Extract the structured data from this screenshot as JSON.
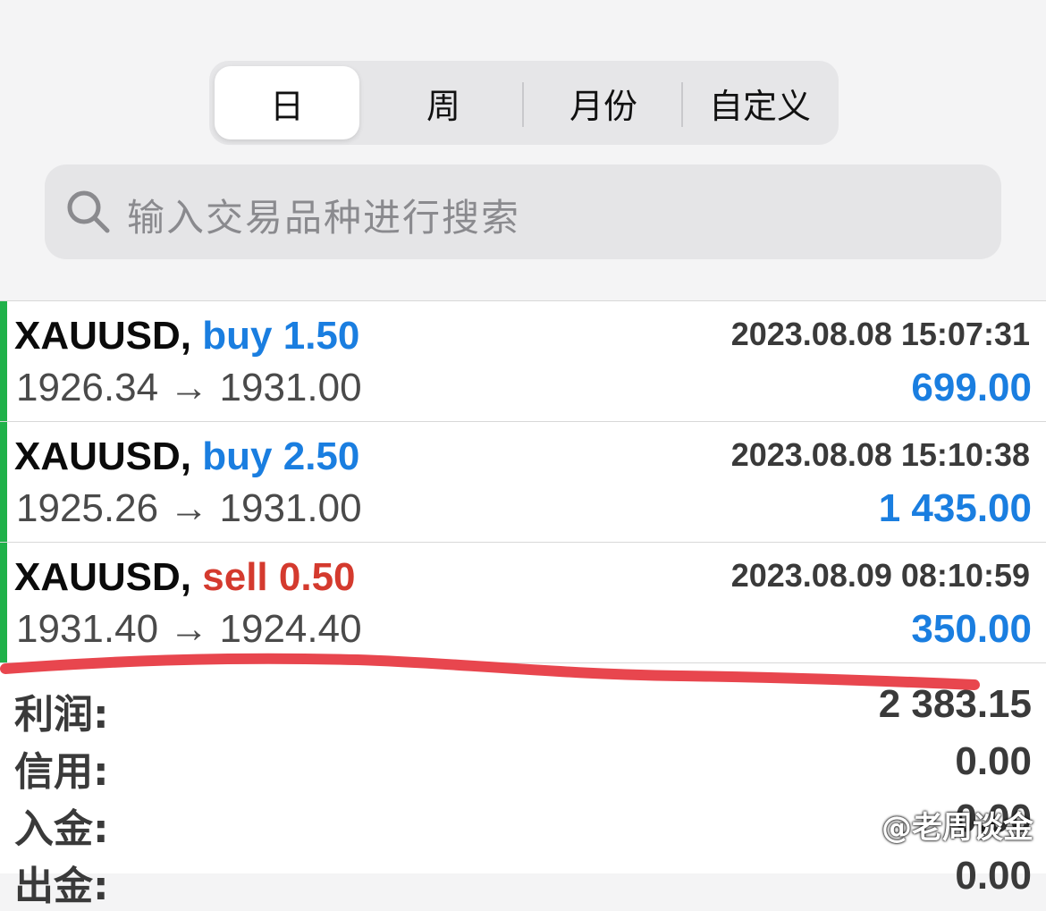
{
  "tabs": [
    {
      "label": "日",
      "active": true
    },
    {
      "label": "周",
      "active": false
    },
    {
      "label": "月份",
      "active": false
    },
    {
      "label": "自定义",
      "active": false
    }
  ],
  "search": {
    "placeholder": "输入交易品种进行搜索"
  },
  "trades": [
    {
      "symbol": "XAUUSD,",
      "direction": "buy",
      "volume": "1.50",
      "time": "2023.08.08 15:07:31",
      "prices": "1926.34 → 1931.00",
      "profit": "699.00"
    },
    {
      "symbol": "XAUUSD,",
      "direction": "buy",
      "volume": "2.50",
      "time": "2023.08.08 15:10:38",
      "prices": "1925.26 → 1931.00",
      "profit": "1 435.00"
    },
    {
      "symbol": "XAUUSD,",
      "direction": "sell",
      "volume": "0.50",
      "time": "2023.08.09 08:10:59",
      "prices": "1931.40 → 1924.40",
      "profit": "350.00"
    }
  ],
  "summary": [
    {
      "label": "利润:",
      "value": "2 383.15"
    },
    {
      "label": "信用:",
      "value": "0.00"
    },
    {
      "label": "入金:",
      "value": "0.00"
    },
    {
      "label": "出金:",
      "value": "0.00"
    }
  ],
  "watermark": "@老周谈金",
  "colors": {
    "buy": "#1a7ee0",
    "sell": "#d43a2e",
    "accent_bar": "#20b14a",
    "annotation": "#e8464e"
  }
}
